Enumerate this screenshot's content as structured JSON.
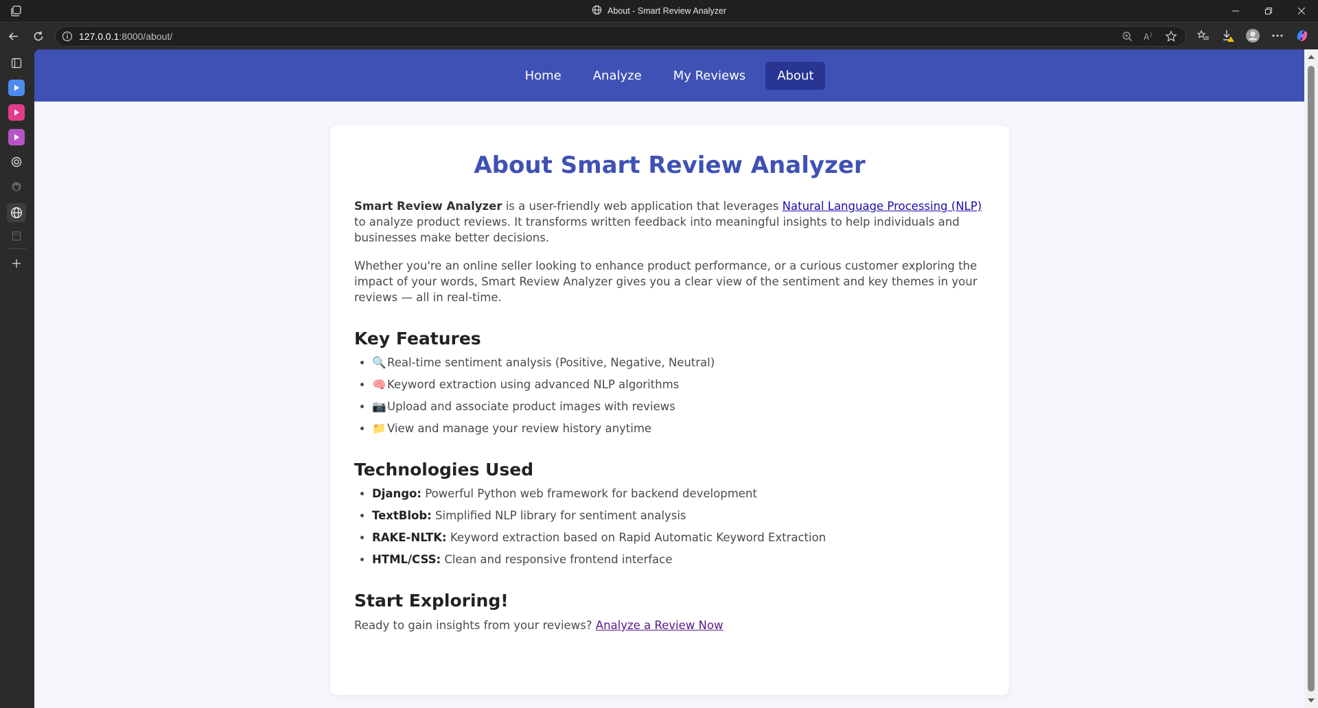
{
  "browser": {
    "window_title": "About - Smart Review Analyzer",
    "url_host": "127.0.0.1",
    "url_rest": ":8000/about/"
  },
  "nav": {
    "items": [
      {
        "label": "Home",
        "active": false
      },
      {
        "label": "Analyze",
        "active": false
      },
      {
        "label": "My Reviews",
        "active": false
      },
      {
        "label": "About",
        "active": true
      }
    ]
  },
  "about": {
    "title": "About Smart Review Analyzer",
    "intro": {
      "brand": "Smart Review Analyzer",
      "text1": " is a user-friendly web application that leverages ",
      "link": "Natural Language Processing (NLP)",
      "text2": " to analyze product reviews. It transforms written feedback into meaningful insights to help individuals and businesses make better decisions."
    },
    "para2": "Whether you're an online seller looking to enhance product performance, or a curious customer exploring the impact of your words, Smart Review Analyzer gives you a clear view of the sentiment and key themes in your reviews — all in real-time.",
    "features": {
      "heading": "Key Features",
      "items": [
        {
          "emoji": "🔍",
          "text": "Real-time sentiment analysis (Positive, Negative, Neutral)"
        },
        {
          "emoji": "🧠",
          "text": "Keyword extraction using advanced NLP algorithms"
        },
        {
          "emoji": "📷",
          "text": "Upload and associate product images with reviews"
        },
        {
          "emoji": "📁",
          "text": "View and manage your review history anytime"
        }
      ]
    },
    "tech": {
      "heading": "Technologies Used",
      "items": [
        {
          "name": "Django:",
          "desc": " Powerful Python web framework for backend development"
        },
        {
          "name": "TextBlob:",
          "desc": " Simplified NLP library for sentiment analysis"
        },
        {
          "name": "RAKE-NLTK:",
          "desc": " Keyword extraction based on Rapid Automatic Keyword Extraction"
        },
        {
          "name": "HTML/CSS:",
          "desc": " Clean and responsive frontend interface"
        }
      ]
    },
    "start": {
      "heading": "Start Exploring!",
      "text": "Ready to gain insights from your reviews? ",
      "link": "Analyze a Review Now"
    }
  },
  "colors": {
    "nav_bg": "#3f51b5",
    "nav_active": "#283593",
    "title": "#3f51b5",
    "page_bg": "#f4f6fb"
  }
}
